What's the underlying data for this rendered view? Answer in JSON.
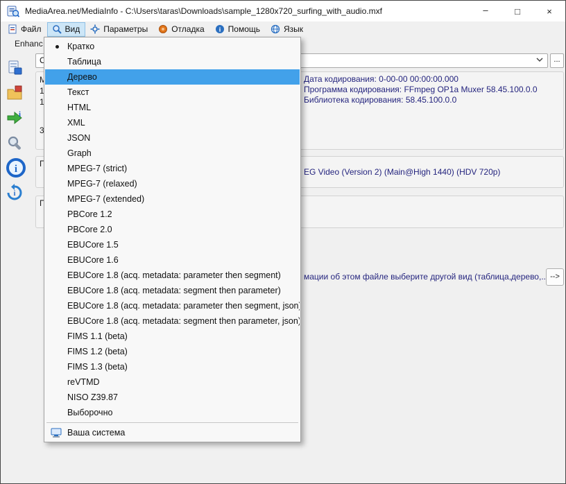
{
  "window": {
    "title": "MediaArea.net/MediaInfo - C:\\Users\\taras\\Downloads\\sample_1280x720_surfing_with_audio.mxf",
    "minimize_glyph": "–",
    "maximize_glyph": "□",
    "close_glyph": "×"
  },
  "menubar": {
    "items": [
      {
        "label": "Файл"
      },
      {
        "label": "Вид"
      },
      {
        "label": "Параметры"
      },
      {
        "label": "Отладка"
      },
      {
        "label": "Помощь"
      },
      {
        "label": "Язык"
      }
    ]
  },
  "view_menu": {
    "items": [
      {
        "label": "Кратко"
      },
      {
        "label": "Таблица"
      },
      {
        "label": "Дерево"
      },
      {
        "label": "Текст"
      },
      {
        "label": "HTML"
      },
      {
        "label": "XML"
      },
      {
        "label": "JSON"
      },
      {
        "label": "Graph"
      },
      {
        "label": "MPEG-7 (strict)"
      },
      {
        "label": "MPEG-7 (relaxed)"
      },
      {
        "label": "MPEG-7 (extended)"
      },
      {
        "label": "PBCore 1.2"
      },
      {
        "label": "PBCore 2.0"
      },
      {
        "label": "EBUCore 1.5"
      },
      {
        "label": "EBUCore 1.6"
      },
      {
        "label": "EBUCore 1.8 (acq. metadata: parameter then segment)"
      },
      {
        "label": "EBUCore 1.8 (acq. metadata: segment then parameter)"
      },
      {
        "label": "EBUCore 1.8 (acq. metadata: parameter then segment, json)"
      },
      {
        "label": "EBUCore 1.8 (acq. metadata: segment then parameter, json)"
      },
      {
        "label": "FIMS 1.1 (beta)"
      },
      {
        "label": "FIMS 1.2 (beta)"
      },
      {
        "label": "FIMS 1.3 (beta)"
      },
      {
        "label": "reVTMD"
      },
      {
        "label": "NISO Z39.87"
      },
      {
        "label": "Выборочно"
      }
    ],
    "selected_item": "Кратко",
    "highlighted_item": "Дерево",
    "system_item": {
      "label": "Ваша система"
    }
  },
  "file_combo": {
    "value": "C:\\Users\\taras\\Downloads\\sample_1280x720_surfing_with_audio.mxf",
    "browse_label": "..."
  },
  "content": {
    "enhanced_fragment": "Enhanc",
    "general": {
      "fragments": [
        "M",
        "1",
        "1",
        "3:"
      ],
      "encoded_date": "Дата кодирования: 0-00-00 00:00:00.000",
      "encoded_application": "Программа кодирования: FFmpeg OP1a Muxer 58.45.100.0.0",
      "encoded_library": "Библиотека кодирования: 58.45.100.0.0"
    },
    "video": {
      "title_fragment": "П",
      "info_fragment": "EG Video (Version 2) (Main@High 1440) (HDV 720p)"
    },
    "audio": {
      "title_fragment": "П"
    },
    "hint": {
      "text_fragment": "мации об этом файле выберите другой вид (таблица,дерево,...)",
      "button_label": "-->"
    }
  }
}
